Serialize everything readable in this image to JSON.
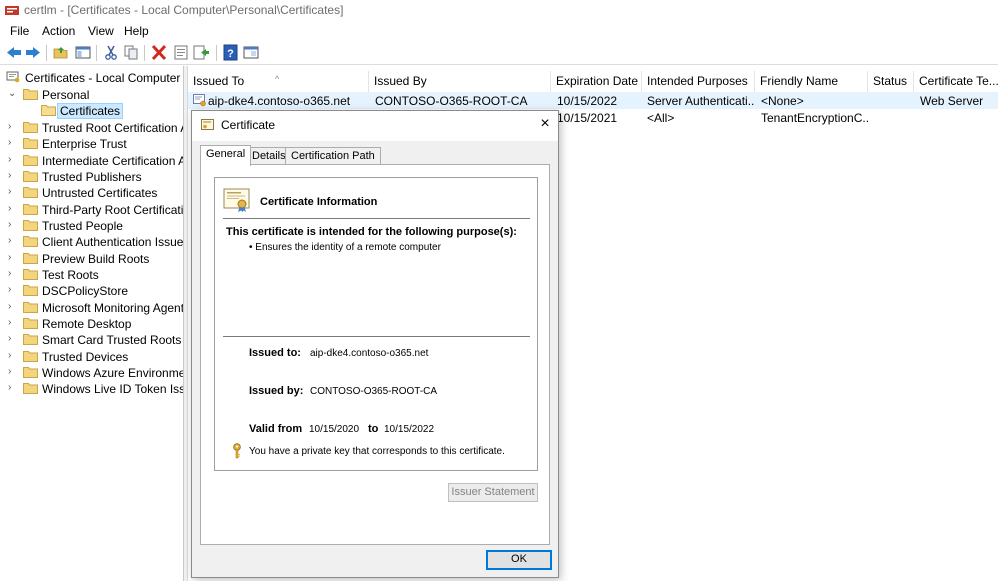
{
  "window": {
    "title": "certlm - [Certificates - Local Computer\\Personal\\Certificates]"
  },
  "menu": [
    "File",
    "Action",
    "View",
    "Help"
  ],
  "toolbar": {
    "icons": [
      "back-arrow-icon",
      "forward-arrow-icon",
      "up-folder-icon",
      "show-hide-tree-icon",
      "cut-icon",
      "copy-icon",
      "delete-icon",
      "properties-icon",
      "export-list-icon",
      "help-icon",
      "console-icon"
    ]
  },
  "tree": {
    "root": "Certificates - Local Computer",
    "personal": "Personal",
    "selected": "Certificates",
    "stores": [
      "Trusted Root Certification Au",
      "Enterprise Trust",
      "Intermediate Certification Au",
      "Trusted Publishers",
      "Untrusted Certificates",
      "Third-Party Root Certification",
      "Trusted People",
      "Client Authentication Issuers",
      "Preview Build Roots",
      "Test Roots",
      "DSCPolicyStore",
      "Microsoft Monitoring Agent",
      "Remote Desktop",
      "Smart Card Trusted Roots",
      "Trusted Devices",
      "Windows Azure Environment",
      "Windows Live ID Token Issuer"
    ]
  },
  "list": {
    "columns": [
      "Issued To",
      "Issued By",
      "Expiration Date",
      "Intended Purposes",
      "Friendly Name",
      "Status",
      "Certificate Te..."
    ],
    "rows": [
      [
        "aip-dke4.contoso-o365.net",
        "CONTOSO-O365-ROOT-CA",
        "10/15/2022",
        "Server Authenticati...",
        "<None>",
        "",
        "Web Server"
      ],
      [
        "",
        "",
        "10/15/2021",
        "<All>",
        "TenantEncryptionC...",
        "",
        ""
      ]
    ]
  },
  "dialog": {
    "title": "Certificate",
    "close": "×",
    "tabs": [
      "General",
      "Details",
      "Certification Path"
    ],
    "info_title": "Certificate Information",
    "purpose_heading": "This certificate is intended for the following purpose(s):",
    "purposes": [
      "• Ensures the identity of a remote computer"
    ],
    "issued_to_label": "Issued to:",
    "issued_to": "aip-dke4.contoso-o365.net",
    "issued_by_label": "Issued by:",
    "issued_by": "CONTOSO-O365-ROOT-CA",
    "valid_from_label": "Valid from",
    "valid_from": "10/15/2020",
    "to_label": "to",
    "valid_to": "10/15/2022",
    "private_key_note": "You have a private key that corresponds to this certificate.",
    "issuer_statement": "Issuer Statement",
    "ok": "OK"
  }
}
